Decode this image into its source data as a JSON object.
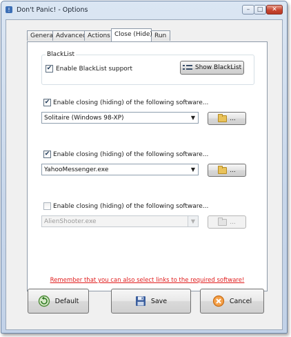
{
  "window": {
    "title": "Don't Panic! - Options",
    "controls": {
      "minimize": "–",
      "maximize": "□",
      "close": "✕"
    }
  },
  "tabs": [
    {
      "label": "General",
      "active": false
    },
    {
      "label": "Advanced",
      "active": false
    },
    {
      "label": "Actions",
      "active": false
    },
    {
      "label": "Close (Hide)",
      "active": true
    },
    {
      "label": "Run",
      "active": false
    }
  ],
  "blacklist": {
    "group_label": "BlackList",
    "enable_label": "Enable BlackList support",
    "enable_checked": true,
    "show_button": "Show BlackList"
  },
  "close_groups": [
    {
      "label": "Enable closing (hiding) of the following software...",
      "checked": true,
      "selected": "Solitaire (Windows 98-XP)",
      "browse": "...",
      "enabled": true
    },
    {
      "label": "Enable closing (hiding) of the following software...",
      "checked": true,
      "selected": "YahooMessenger.exe",
      "browse": "...",
      "enabled": true
    },
    {
      "label": "Enable closing (hiding) of the following software...",
      "checked": false,
      "selected": "AlienShooter.exe",
      "browse": "...",
      "enabled": false
    }
  ],
  "note": "Remember that you can also select links to the required software!",
  "buttons": {
    "default": "Default",
    "save": "Save",
    "cancel": "Cancel"
  },
  "colors": {
    "note": "#e01a1a",
    "accent": "#4a74b8"
  }
}
